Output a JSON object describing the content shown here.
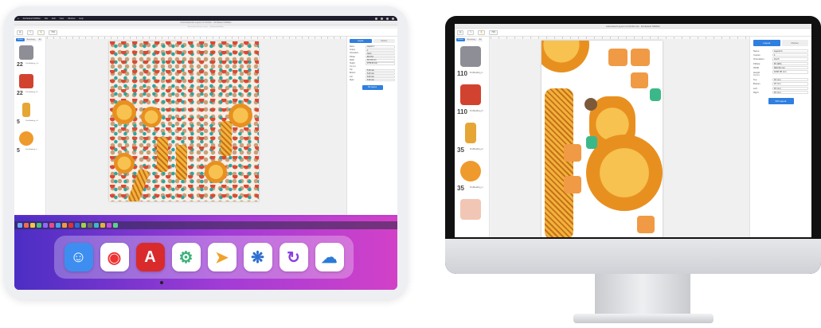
{
  "tablet": {
    "menubar": {
      "app": "Zünfteland Stiftfilter",
      "items": [
        "File",
        "Edit",
        "View",
        "Window",
        "Help"
      ]
    },
    "window_title": "Automatisiertes Layout mit Zünfter · Zünfteland Stiftfilter",
    "window_subtitle": "Automated Sticker Layout · ZünftelandStiftfilter",
    "toolbar": {
      "zoom": "79%"
    },
    "sidebar": {
      "tabs": [
        "Stücke",
        "Bestellung",
        "All"
      ],
      "items": [
        {
          "qty": "22",
          "name": "PurrBedding_Ca",
          "color": "#8e8e96"
        },
        {
          "qty": "22",
          "name": "PurrBedding_Di",
          "color": "#d2432f"
        },
        {
          "qty": "5",
          "name": "PurrBedding_Gi",
          "color": "#e6a635"
        },
        {
          "qty": "5",
          "name": "PurrBedding_Li",
          "color": "#ef9a2d"
        }
      ]
    },
    "properties": {
      "tabs": [
        "Layout",
        "Medien"
      ],
      "rows": [
        {
          "k": "Name",
          "v": "Layout 1"
        },
        {
          "k": "Copies",
          "v": "1"
        },
        {
          "k": "Orientation",
          "v": "Hoch"
        },
        {
          "k": "Fillrate",
          "v": "86.57%"
        },
        {
          "k": "Width",
          "v": "914.00 mm"
        },
        {
          "k": "Height",
          "v": "2763.00 mm"
        }
      ],
      "margins_label": "Margins",
      "margins": [
        {
          "k": "Top",
          "v": "5.00 mm"
        },
        {
          "k": "Bottom",
          "v": "5.00 mm"
        },
        {
          "k": "Left",
          "v": "5.00 mm"
        },
        {
          "k": "Right",
          "v": "5.00 mm"
        }
      ],
      "button": "Fill Layout"
    },
    "dock": [
      {
        "name": "finder-icon",
        "glyph": "☺",
        "bg": "#3d8ef0"
      },
      {
        "name": "chrome-icon",
        "glyph": "◉",
        "bg": "#ffffff"
      },
      {
        "name": "acrobat-icon",
        "glyph": "A",
        "bg": "#d92b2b"
      },
      {
        "name": "gear-app-icon",
        "glyph": "⚙",
        "bg": "#ffffff"
      },
      {
        "name": "send-app-icon",
        "glyph": "➤",
        "bg": "#ffffff"
      },
      {
        "name": "blob-app-icon",
        "glyph": "❋",
        "bg": "#ffffff"
      },
      {
        "name": "sync-app-icon",
        "glyph": "↻",
        "bg": "#ffffff"
      },
      {
        "name": "onedrive-icon",
        "glyph": "☁",
        "bg": "#ffffff"
      }
    ]
  },
  "monitor": {
    "window_title": "Automated Layout mit Zünfter lab · Zünfteland Stiftfilter",
    "toolbar": {
      "zoom": "79%"
    },
    "sidebar": {
      "tabs": [
        "Stücke",
        "Bestellung",
        "All"
      ],
      "items": [
        {
          "qty": "110",
          "name": "PurrBedding_C",
          "color": "#8e8e96"
        },
        {
          "qty": "110",
          "name": "PurrBedding_D",
          "color": "#d2432f"
        },
        {
          "qty": "35",
          "name": "PurrBedding_Fi",
          "color": "#e6a635"
        },
        {
          "qty": "35",
          "name": "PurrBedding_Li",
          "color": "#ef9a2d"
        },
        {
          "qty": "",
          "name": "",
          "color": "#f2c6b4"
        }
      ]
    },
    "properties": {
      "tabs": [
        "Layout",
        "Medien"
      ],
      "rows": [
        {
          "k": "Name",
          "v": "Layout 1"
        },
        {
          "k": "Copies",
          "v": "1"
        },
        {
          "k": "Orientation",
          "v": "Hoch"
        },
        {
          "k": "Fillrate",
          "v": "87.00%"
        },
        {
          "k": "Width",
          "v": "609.60 mm"
        },
        {
          "k": "Height",
          "v": "1000.00 mm"
        }
      ],
      "margins_label": "Margins",
      "margins": [
        {
          "k": "Top",
          "v": "15 mm"
        },
        {
          "k": "Bottom",
          "v": "15 mm"
        },
        {
          "k": "Left",
          "v": "15 mm"
        },
        {
          "k": "Right",
          "v": "15 mm"
        }
      ],
      "button": "Fill Layout"
    }
  }
}
